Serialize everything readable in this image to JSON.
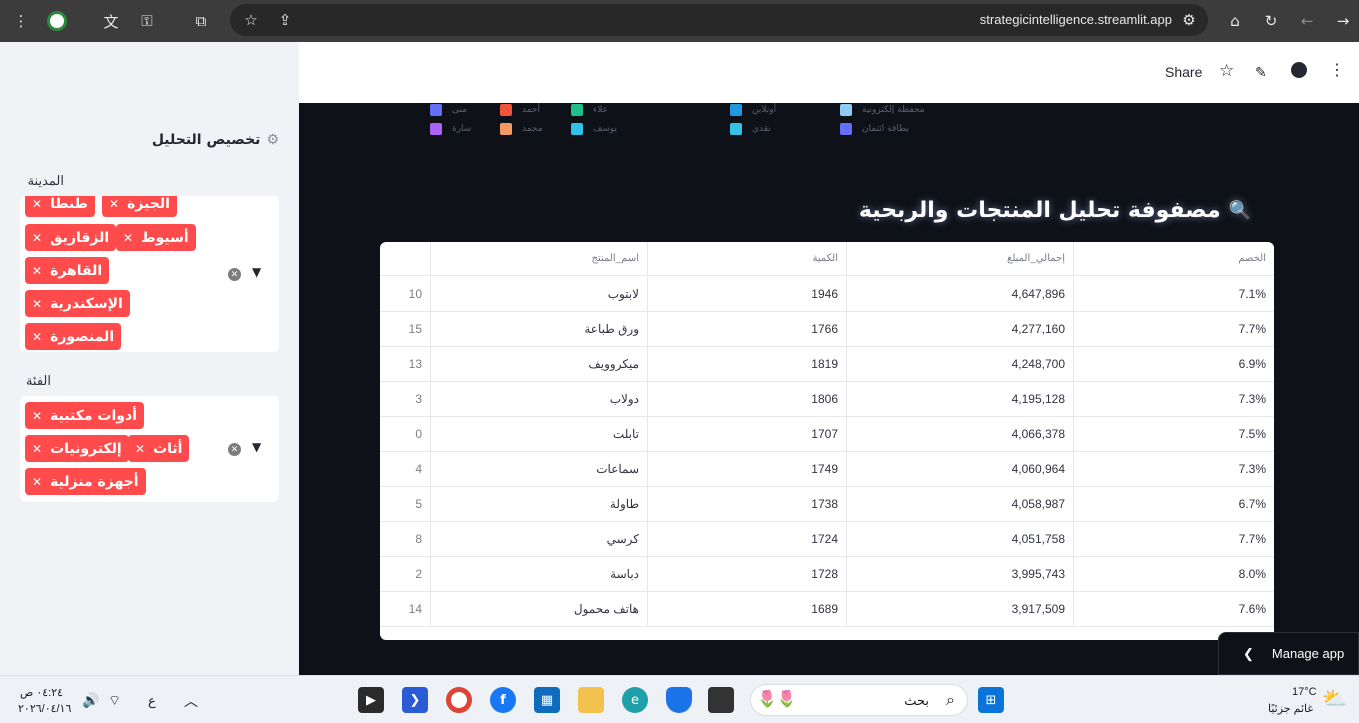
{
  "browser": {
    "url": "strategicintelligence.streamlit.app",
    "icons": [
      "menu-icon",
      "extension-icon",
      "translate-icon",
      "key-icon",
      "puzzle-icon",
      "star-icon",
      "install-icon",
      "site-settings-icon",
      "home-icon",
      "reload-icon",
      "back-icon",
      "forward-icon"
    ]
  },
  "header": {
    "share": "Share"
  },
  "sidebar": {
    "title": "تخصيص التحليل",
    "city": {
      "label": "المدينة",
      "tags": [
        "طنطا",
        "الجيزة",
        "أسيوط",
        "الزقازيق",
        "القاهرة",
        "الإسكندرية",
        "المنصورة"
      ]
    },
    "category": {
      "label": "الفئة",
      "tags": [
        "أدوات مكتبية",
        "أثاث",
        "إلكترونيات",
        "أجهزة منزلية"
      ]
    }
  },
  "legend": [
    {
      "label": "محفظة إلكترونية",
      "color": "#8ecbf5"
    },
    {
      "label": "بطاقة ائتمان",
      "color": "#636efa"
    },
    {
      "label": "أونلاين",
      "color": "#1f9ae0"
    },
    {
      "label": "نقدي",
      "color": "#35c0e8"
    },
    {
      "label": "علاء",
      "color": "#20c08a"
    },
    {
      "label": "يوسف",
      "color": "#2fc4e6"
    },
    {
      "label": "أحمد",
      "color": "#ef553b"
    },
    {
      "label": "محمد",
      "color": "#f79a62"
    },
    {
      "label": "منى",
      "color": "#636efa"
    },
    {
      "label": "سارة",
      "color": "#ab63fa"
    }
  ],
  "main": {
    "title": "مصفوفة تحليل المنتجات والربحية",
    "table": {
      "columns": {
        "name": "اسم_المنتج",
        "qty": "الكمية",
        "total": "إجمالي_المبلغ",
        "discount": "الخصم"
      },
      "rows": [
        {
          "idx": "10",
          "name": "لابتوب",
          "qty": "1946",
          "total": "4,647,896",
          "discount": "7.1%"
        },
        {
          "idx": "15",
          "name": "ورق طباعة",
          "qty": "1766",
          "total": "4,277,160",
          "discount": "7.7%"
        },
        {
          "idx": "13",
          "name": "ميكروويف",
          "qty": "1819",
          "total": "4,248,700",
          "discount": "6.9%"
        },
        {
          "idx": "3",
          "name": "دولاب",
          "qty": "1806",
          "total": "4,195,128",
          "discount": "7.3%"
        },
        {
          "idx": "0",
          "name": "تابلت",
          "qty": "1707",
          "total": "4,066,378",
          "discount": "7.5%"
        },
        {
          "idx": "4",
          "name": "سماعات",
          "qty": "1749",
          "total": "4,060,964",
          "discount": "7.3%"
        },
        {
          "idx": "5",
          "name": "طاولة",
          "qty": "1738",
          "total": "4,058,987",
          "discount": "6.7%"
        },
        {
          "idx": "8",
          "name": "كرسي",
          "qty": "1724",
          "total": "4,051,758",
          "discount": "7.7%"
        },
        {
          "idx": "2",
          "name": "دباسة",
          "qty": "1728",
          "total": "3,995,743",
          "discount": "8.0%"
        },
        {
          "idx": "14",
          "name": "هاتف محمول",
          "qty": "1689",
          "total": "3,917,509",
          "discount": "7.6%"
        }
      ]
    }
  },
  "manage": {
    "label": "Manage app"
  },
  "taskbar": {
    "search": "بحث",
    "temp": "17°C",
    "weather": "غائم جزئيًا",
    "time": "٠٤:٢٤ ص",
    "date": "٢٠٢٦/٠٤/١٦",
    "lang": "ع"
  }
}
